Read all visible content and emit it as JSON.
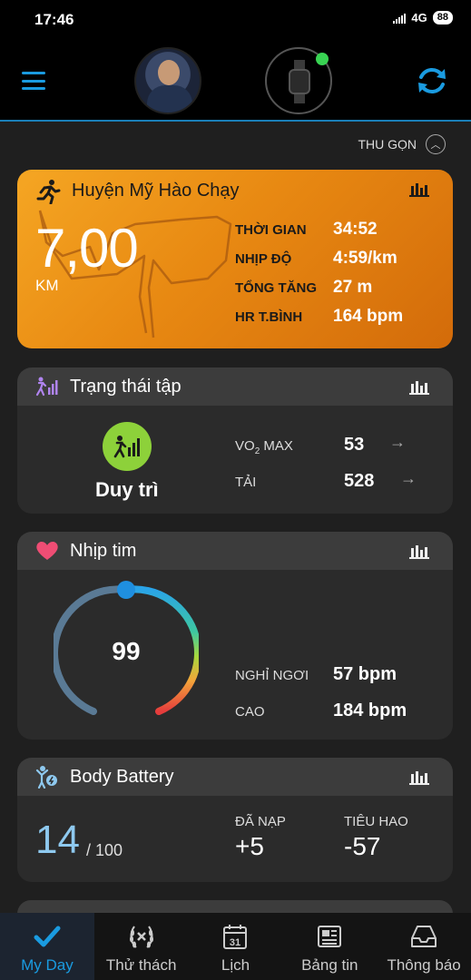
{
  "status_bar": {
    "time": "17:46",
    "network": "4G",
    "battery": "88"
  },
  "collapse": {
    "label": "THU GỌN"
  },
  "activity": {
    "title": "Huyện Mỹ Hào Chạy",
    "distance": "7,00",
    "unit": "KM",
    "stats": [
      {
        "label": "THỜI GIAN",
        "value": "34:52"
      },
      {
        "label": "NHỊP ĐỘ",
        "value": "4:59/km"
      },
      {
        "label": "TỔNG TĂNG",
        "value": "27 m"
      },
      {
        "label": "HR T.BÌNH",
        "value": "164 bpm"
      }
    ]
  },
  "training": {
    "title": "Trạng thái tập",
    "status": "Duy trì",
    "vo2_label_main": "VO",
    "vo2_label_sub": "2",
    "vo2_label_rest": " MAX",
    "vo2_value": "53",
    "load_label": "TẢI",
    "load_value": "528"
  },
  "heart_rate": {
    "title": "Nhịp tim",
    "current": "99",
    "resting_label": "NGHỈ NGƠI",
    "resting_value": "57 bpm",
    "high_label": "CAO",
    "high_value": "184 bpm"
  },
  "body_battery": {
    "title": "Body Battery",
    "level": "14",
    "max": "/ 100",
    "charged_label": "ĐÃ NẠP",
    "charged_value": "+5",
    "drained_label": "TIÊU HAO",
    "drained_value": "-57"
  },
  "tabs": [
    {
      "label": "My Day",
      "icon": "checkmark-icon",
      "active": true
    },
    {
      "label": "Thử thách",
      "icon": "laurel-icon",
      "active": false
    },
    {
      "label": "Lịch",
      "icon": "calendar-icon",
      "active": false
    },
    {
      "label": "Bảng tin",
      "icon": "newsfeed-icon",
      "active": false
    },
    {
      "label": "Thông báo",
      "icon": "inbox-icon",
      "active": false
    }
  ],
  "calendar_day": "31",
  "colors": {
    "accent": "#1a9be0",
    "activity": "#f0941a",
    "training_green": "#8dd13a",
    "battery_blue": "#8ec9ef"
  }
}
